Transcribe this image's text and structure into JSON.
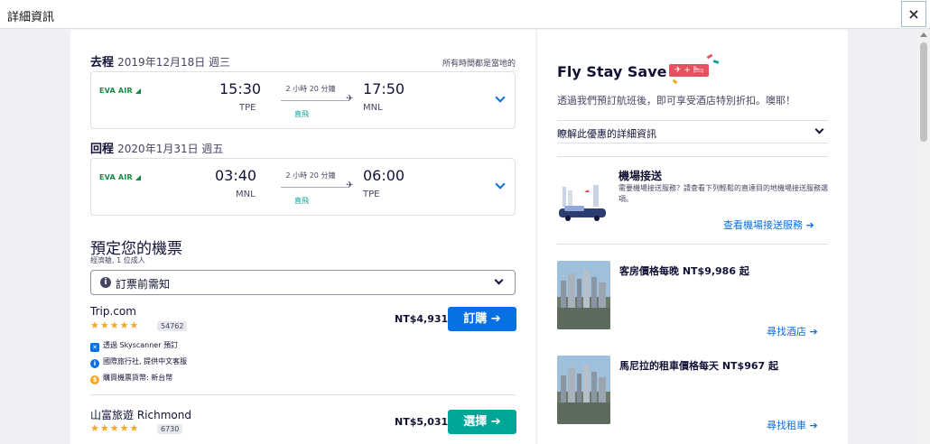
{
  "header": {
    "title": "詳細資訊",
    "close_icon": "×"
  },
  "outbound": {
    "label": "去程",
    "date": "2019年12月18日 週三",
    "tz_note": "所有時間都是當地的",
    "airline_logo": "EVA AIR",
    "depart_time": "15:30",
    "depart_airport": "TPE",
    "duration": "2 小時 20 分鐘",
    "stops": "直飛",
    "arrive_time": "17:50",
    "arrive_airport": "MNL"
  },
  "inbound": {
    "label": "回程",
    "date": "2020年1月31日 週五",
    "airline_logo": "EVA AIR",
    "depart_time": "03:40",
    "depart_airport": "MNL",
    "duration": "2 小時 20 分鐘",
    "stops": "直飛",
    "arrive_time": "06:00",
    "arrive_airport": "TPE"
  },
  "booking": {
    "title": "預定您的機票",
    "subtitle": "經濟艙, 1 位成人",
    "notice_label": "訂票前需知",
    "providers": [
      {
        "name": "Trip.com",
        "stars": "★★★★★",
        "reviews": "54762",
        "features": [
          "透過 Skyscanner 預訂",
          "國際旅行社, 提供中文客服",
          "購買機票貨幣: 新台幣"
        ],
        "price": "NT$4,931",
        "button": "訂購 ➔"
      },
      {
        "name": "山富旅遊 Richmond",
        "stars": "★★★★★",
        "reviews": "6730",
        "price": "NT$5,031",
        "button": "選擇 ➔"
      }
    ]
  },
  "fly_stay_save": {
    "title": "Fly Stay Save",
    "badge": "✈ + 🛏",
    "description": "透過我們預訂航班後，即可享受酒店特別折扣。噢耶！",
    "details_link": "瞭解此優惠的詳細資訊"
  },
  "transfer": {
    "title": "機場接送",
    "description": "需要機場接送服務？請查看下列輕鬆的直達目的地機場接送服務選項。",
    "link": "查看機場接送服務"
  },
  "hotel": {
    "text": "客房價格每晚 NT$9,986 起",
    "link": "尋找酒店"
  },
  "car": {
    "text": "馬尼拉的租車價格每天 NT$967 起",
    "link": "尋找租車"
  }
}
